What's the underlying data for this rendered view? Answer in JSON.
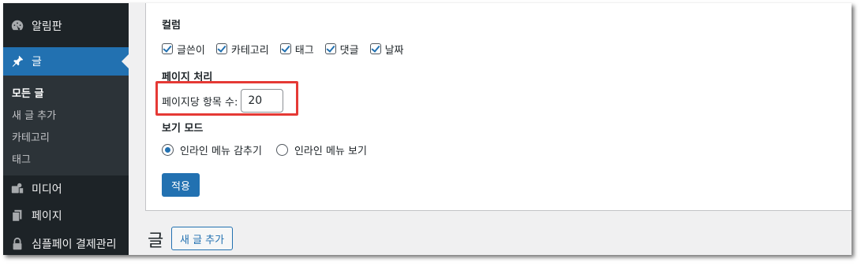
{
  "sidebar": {
    "items": [
      {
        "label": "알림판",
        "icon": "dashboard-icon"
      },
      {
        "label": "글",
        "icon": "pin-icon",
        "active": true
      },
      {
        "label": "미디어",
        "icon": "media-icon"
      },
      {
        "label": "페이지",
        "icon": "page-icon"
      },
      {
        "label": "심플페이 결제관리",
        "icon": "lock-icon"
      }
    ],
    "submenu": [
      "모든 글",
      "새 글 추가",
      "카테고리",
      "태그"
    ]
  },
  "screen_options": {
    "columns_legend": "컬럼",
    "columns": [
      {
        "label": "글쓴이",
        "checked": true
      },
      {
        "label": "카테고리",
        "checked": true
      },
      {
        "label": "태그",
        "checked": true
      },
      {
        "label": "댓글",
        "checked": true
      },
      {
        "label": "날짜",
        "checked": true
      }
    ],
    "pagination_legend": "페이지 처리",
    "per_page_label": "페이지당 항목 수:",
    "per_page_value": "20",
    "view_mode_legend": "보기 모드",
    "view_modes": [
      {
        "label": "인라인 메뉴 감추기",
        "selected": true
      },
      {
        "label": "인라인 메뉴 보기",
        "selected": false
      }
    ],
    "apply_label": "적용"
  },
  "page": {
    "heading": "글",
    "add_new_label": "새 글 추가"
  },
  "colors": {
    "sidebar_bg": "#1d2327",
    "accent": "#2271b1",
    "highlight": "#e53935"
  }
}
